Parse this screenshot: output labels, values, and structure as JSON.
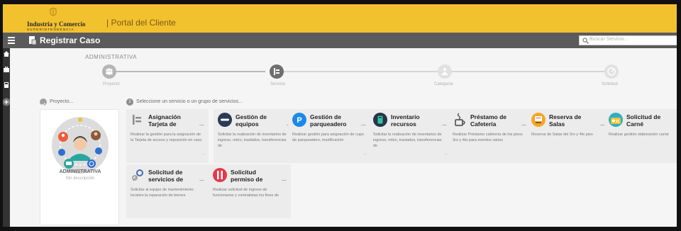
{
  "brand": {
    "line1": "Industria y Comercio",
    "line2": "SUPERINTENDENCIA",
    "portal": "| Portal del Cliente"
  },
  "appbar": {
    "title": "Registrar Caso",
    "search_placeholder": "Buscar Servicio..."
  },
  "breadcrumb": "ADMINISTRATIVA",
  "steps": [
    {
      "label": "Proyecto",
      "state": "completed"
    },
    {
      "label": "Servicio",
      "state": "active"
    },
    {
      "label": "Categoría",
      "state": "inactive"
    },
    {
      "label": "Solicitud",
      "state": "inactive"
    }
  ],
  "project_section": {
    "label": "Proyecto...",
    "card_title": "ADMINISTRATIVA",
    "card_desc": "Sin descripción"
  },
  "service_section": {
    "number": "2",
    "label": "Seleccione un servicio o un grupo de servicios..."
  },
  "services": [
    {
      "title": "Asignación Tarjeta de",
      "icon": "id-card-icon",
      "dots": "...",
      "desc": "Realizar la gestión para la asignación de la Tarjeta de acceso y reposición en caso",
      "more": "..."
    },
    {
      "title": "Gestión de equipos",
      "icon": "equipment-icon",
      "dots": "...",
      "desc": "Solicitar la realización de inventarios de ingreso, retiro, traslados, transferencias de",
      "more": "..."
    },
    {
      "title": "Gestión de parqueadero",
      "icon": "parking-icon",
      "dots": "...",
      "desc": "Realizar gestión para asignación de cupo de parqueadero, modificación",
      "more": "..."
    },
    {
      "title": "Inventario recursos",
      "icon": "inventory-icon",
      "dots": "...",
      "desc": "Solicitar la realización de inventarios de ingreso, retiro, traslados, transferencias de",
      "more": "..."
    },
    {
      "title": "Préstamo de Cafetería",
      "icon": "coffee-icon",
      "dots": "...",
      "desc": "Realizar Préstamo cafetería de los pisos 3ro y 4to para eventos varios",
      "more": ""
    },
    {
      "title": "Reserva de Salas",
      "icon": "meeting-room-icon",
      "dots": "...",
      "desc": "Reserva de Salas del 3ro y 4to piso",
      "more": ""
    },
    {
      "title": "Solicitud de Carné",
      "icon": "id-badge-icon",
      "dots": "...",
      "desc": "Realizar gestión elaboración carné",
      "more": ""
    },
    {
      "title": "Solicitud de servicios de",
      "icon": "maintenance-icon",
      "dots": "...",
      "desc": "Solicitar al equipo de mantenimiento locativo la reparación de bienes",
      "more": ""
    },
    {
      "title": "Solicitud permiso de",
      "icon": "permit-icon",
      "dots": "...",
      "desc": "Realizar solicitud de ingreso de funcionarios y contratistas los fines de",
      "more": ""
    }
  ]
}
